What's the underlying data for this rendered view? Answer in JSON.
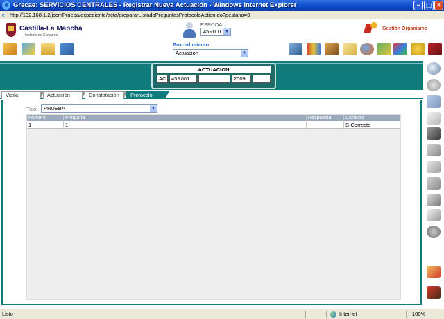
{
  "window": {
    "title": "Grecae: SERVICIOS CENTRALES - Registrar Nueva Actuación - Windows Internet Explorer",
    "address": "http://192.168.1.2/jccmPrueba/expediente/acta/prepararListadoPreguntasProtocoloAction.do?pestana=3"
  },
  "header": {
    "logo_text": "Castilla-La Mancha",
    "logo_subtext": "Instituto de Consumo",
    "user_label": "ESPCOAL",
    "user_select": "45R001",
    "org_text": "Gestión Organismo",
    "procedure_label": "Procedimiento:",
    "procedure_select": "Actuación",
    "left_icons": [
      "cube-icon",
      "shield-key-icon",
      "folder-icon",
      "computer-box-icon"
    ],
    "right_icons": [
      "laptop-icon",
      "books-icon",
      "boxes-icon",
      "envelope-icon",
      "firefox-icon",
      "magnifier-map-icon",
      "puzzle-icon",
      "gears-icon",
      "exit-book-icon"
    ]
  },
  "actuacion": {
    "title": "ACTUACION",
    "cells": [
      "AC",
      "45R001",
      "",
      "2009",
      ""
    ]
  },
  "tabs": [
    {
      "label": "Visita",
      "active": false
    },
    {
      "label": "Actuación",
      "active": false
    },
    {
      "label": "Constatación",
      "active": false
    },
    {
      "label": "Protocolo",
      "active": true
    }
  ],
  "form": {
    "tipo_label": "Tipo:",
    "tipo_value": "PRUEBA"
  },
  "table": {
    "columns": [
      "Número",
      "Pregunta",
      "Respuesta",
      "Correcta"
    ],
    "rows": [
      {
        "numero": "1",
        "pregunta": "1",
        "respuesta": "-",
        "correcta": "S-Correcto"
      }
    ]
  },
  "right_toolbar": [
    "search-icon",
    "back-icon",
    "eraser-icon",
    "documents-icon",
    "save-icon",
    "delete-icon",
    "copy-icon",
    "attachment-icon",
    "print-icon",
    "pdf-icon",
    "settings-icon",
    "clear-form-icon",
    "tractor-icon"
  ],
  "statusbar": {
    "left_text": "Listo",
    "zone": "Internet",
    "zoom": "100%"
  },
  "colors": {
    "teal": "#0f7b7a",
    "title_blue": "#0a48c8",
    "table_header": "#9aa9bc"
  }
}
